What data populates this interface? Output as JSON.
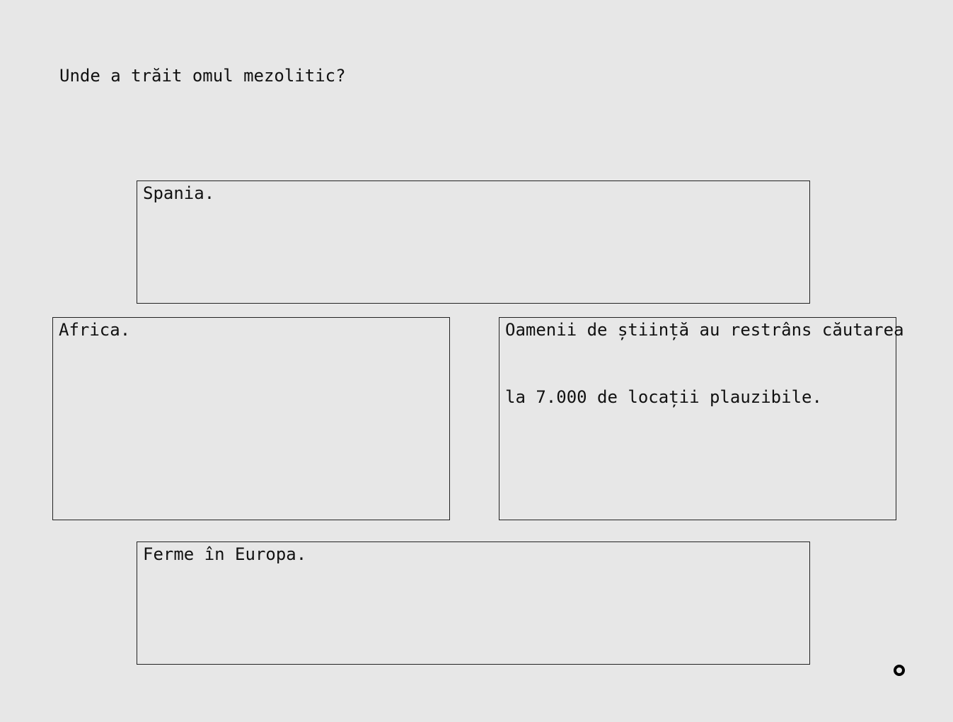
{
  "question": "Unde a trăit omul mezolitic?",
  "options": [
    {
      "id": "a",
      "label": "Spania."
    },
    {
      "id": "b",
      "label": "Africa."
    },
    {
      "id": "c",
      "lines": [
        "Oamenii de știință au restrâns căutarea",
        "la 7.000 de locații plauzibile."
      ]
    },
    {
      "id": "d",
      "label": "Ferme în Europa."
    }
  ],
  "icons": {
    "corner": "ring-icon"
  }
}
